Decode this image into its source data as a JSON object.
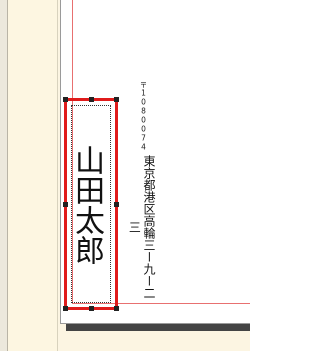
{
  "envelope": {
    "postal_code": "〒1080074",
    "address": "東京都港区高輪三ー九ー二三",
    "name": "山田太郎"
  },
  "colors": {
    "selection": "#e01b1b",
    "margin_guide": "#e87070",
    "background": "#fcf5e2"
  }
}
